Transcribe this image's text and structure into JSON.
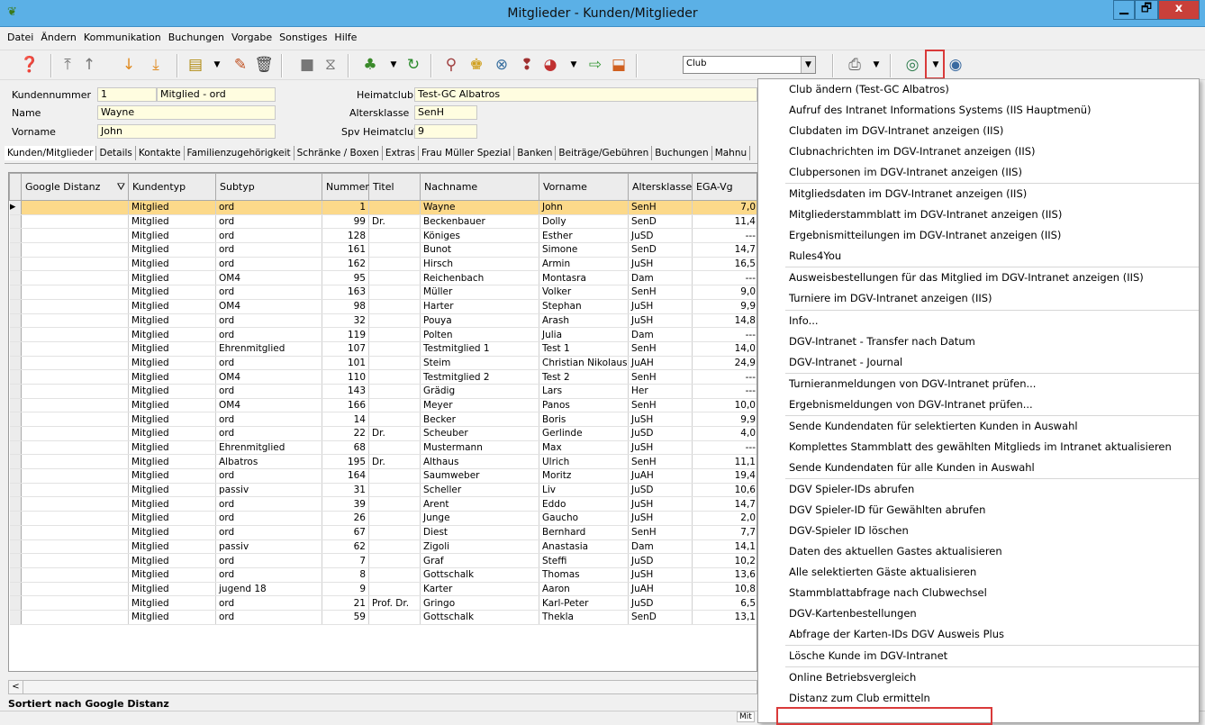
{
  "window": {
    "title": "Mitglieder - Kunden/Mitglieder",
    "min": "▁",
    "max": "🗗",
    "close": "x"
  },
  "menubar": [
    "Datei",
    "Ändern",
    "Kommunikation",
    "Buchungen",
    "Vorgabe",
    "Sonstiges",
    "Hilfe"
  ],
  "toolbar": {
    "combo_value": "Club",
    "icons": [
      "help-icon",
      "move-top-icon",
      "move-up-icon",
      "move-down-icon",
      "move-bottom-icon",
      "document-icon",
      "edit-pencil-icon",
      "delete-icon",
      "stop-icon",
      "filter-icon",
      "people-icon",
      "refresh-icon",
      "search-person-icon",
      "group-icon",
      "lifebuoy-icon",
      "question-icon",
      "pie-chart-icon",
      "export-icon",
      "import-icon",
      "print-icon",
      "intranet-icon",
      "intranet-globe-icon"
    ]
  },
  "form": {
    "kundennummer_label": "Kundennummer",
    "kundennummer": "1",
    "mitglied_typ": "Mitglied - ord",
    "name_label": "Name",
    "name": "Wayne",
    "vorname_label": "Vorname",
    "vorname": "John",
    "heimatclub_label": "Heimatclub",
    "heimatclub": "Test-GC Albatros",
    "altersklasse_label": "Altersklasse",
    "altersklasse": "SenH",
    "spv_label": "Spv Heimatclub",
    "spv": "9"
  },
  "tabs": [
    "Kunden/Mitglieder",
    "Details",
    "Kontakte",
    "Familienzugehörigkeit",
    "Schränke / Boxen",
    "Extras",
    "Frau Müller Spezial",
    "Banken",
    "Beiträge/Gebühren",
    "Buchungen",
    "Mahnu"
  ],
  "grid": {
    "columns": [
      "Google Distanz",
      "Kundentyp",
      "Subtyp",
      "Nummer",
      "Titel",
      "Nachname",
      "Vorname",
      "Altersklasse",
      "EGA-Vg"
    ],
    "rows": [
      [
        "",
        "Mitglied",
        "ord",
        "1",
        "",
        "Wayne",
        "John",
        "SenH",
        "7,0"
      ],
      [
        "",
        "Mitglied",
        "ord",
        "99",
        "Dr.",
        "Beckenbauer",
        "Dolly",
        "SenD",
        "11,4"
      ],
      [
        "",
        "Mitglied",
        "ord",
        "128",
        "",
        "Königes",
        "Esther",
        "JuSD",
        "---"
      ],
      [
        "",
        "Mitglied",
        "ord",
        "161",
        "",
        "Bunot",
        "Simone",
        "SenD",
        "14,7"
      ],
      [
        "",
        "Mitglied",
        "ord",
        "162",
        "",
        "Hirsch",
        "Armin",
        "JuSH",
        "16,5"
      ],
      [
        "",
        "Mitglied",
        "OM4",
        "95",
        "",
        "Reichenbach",
        "Montasra",
        "Dam",
        "---"
      ],
      [
        "",
        "Mitglied",
        "ord",
        "163",
        "",
        "Müller",
        "Volker",
        "SenH",
        "9,0"
      ],
      [
        "",
        "Mitglied",
        "OM4",
        "98",
        "",
        "Harter",
        "Stephan",
        "JuSH",
        "9,9"
      ],
      [
        "",
        "Mitglied",
        "ord",
        "32",
        "",
        "Pouya",
        "Arash",
        "JuSH",
        "14,8"
      ],
      [
        "",
        "Mitglied",
        "ord",
        "119",
        "",
        "Polten",
        "Julia",
        "Dam",
        "---"
      ],
      [
        "",
        "Mitglied",
        "Ehrenmitglied",
        "107",
        "",
        "Testmitglied 1",
        "Test 1",
        "SenH",
        "14,0"
      ],
      [
        "",
        "Mitglied",
        "ord",
        "101",
        "",
        "Steim",
        "Christian Nikolaus",
        "JuAH",
        "24,9"
      ],
      [
        "",
        "Mitglied",
        "OM4",
        "110",
        "",
        "Testmitglied 2",
        "Test 2",
        "SenH",
        "---"
      ],
      [
        "",
        "Mitglied",
        "ord",
        "143",
        "",
        "Grädig",
        "Lars",
        "Her",
        "---"
      ],
      [
        "",
        "Mitglied",
        "OM4",
        "166",
        "",
        "Meyer",
        "Panos",
        "SenH",
        "10,0"
      ],
      [
        "",
        "Mitglied",
        "ord",
        "14",
        "",
        "Becker",
        "Boris",
        "JuSH",
        "9,9"
      ],
      [
        "",
        "Mitglied",
        "ord",
        "22",
        "Dr.",
        "Scheuber",
        "Gerlinde",
        "JuSD",
        "4,0"
      ],
      [
        "",
        "Mitglied",
        "Ehrenmitglied",
        "68",
        "",
        "Mustermann",
        "Max",
        "JuSH",
        "---"
      ],
      [
        "",
        "Mitglied",
        "Albatros",
        "195",
        "Dr.",
        "Althaus",
        "Ulrich",
        "SenH",
        "11,1"
      ],
      [
        "",
        "Mitglied",
        "ord",
        "164",
        "",
        "Saumweber",
        "Moritz",
        "JuAH",
        "19,4"
      ],
      [
        "",
        "Mitglied",
        "passiv",
        "31",
        "",
        "Scheller",
        "Liv",
        "JuSD",
        "10,6"
      ],
      [
        "",
        "Mitglied",
        "ord",
        "39",
        "",
        "Arent",
        "Eddo",
        "JuSH",
        "14,7"
      ],
      [
        "",
        "Mitglied",
        "ord",
        "26",
        "",
        "Junge",
        "Gaucho",
        "JuSH",
        "2,0"
      ],
      [
        "",
        "Mitglied",
        "ord",
        "67",
        "",
        "Diest",
        "Bernhard",
        "SenH",
        "7,7"
      ],
      [
        "",
        "Mitglied",
        "passiv",
        "62",
        "",
        "Zigoli",
        "Anastasia",
        "Dam",
        "14,1"
      ],
      [
        "",
        "Mitglied",
        "ord",
        "7",
        "",
        "Graf",
        "Steffi",
        "JuSD",
        "10,2"
      ],
      [
        "",
        "Mitglied",
        "ord",
        "8",
        "",
        "Gottschalk",
        "Thomas",
        "JuSH",
        "13,6"
      ],
      [
        "",
        "Mitglied",
        "jugend 18",
        "9",
        "",
        "Karter",
        "Aaron",
        "JuAH",
        "10,8"
      ],
      [
        "",
        "Mitglied",
        "ord",
        "21",
        "Prof. Dr.",
        "Gringo",
        "Karl-Peter",
        "JuSD",
        "6,5"
      ],
      [
        "",
        "Mitglied",
        "ord",
        "59",
        "",
        "Gottschalk",
        "Thekla",
        "SenD",
        "13,1"
      ]
    ]
  },
  "status": "Sortiert nach Google Distanz",
  "bottom_fragment": "Mit",
  "context_menu": [
    {
      "label": "Club ändern (Test-GC Albatros)",
      "sep": false
    },
    {
      "label": "Aufruf des Intranet Informations Systems (IIS Hauptmenü)",
      "sep": false
    },
    {
      "label": "Clubdaten im DGV-Intranet anzeigen (IIS)",
      "sep": false
    },
    {
      "label": "Clubnachrichten im DGV-Intranet anzeigen (IIS)",
      "sep": false
    },
    {
      "label": "Clubpersonen im DGV-Intranet anzeigen (IIS)",
      "sep": true
    },
    {
      "label": "Mitgliedsdaten im DGV-Intranet anzeigen (IIS)",
      "sep": false
    },
    {
      "label": "Mitgliederstammblatt im DGV-Intranet anzeigen (IIS)",
      "sep": false
    },
    {
      "label": "Ergebnismitteilungen im DGV-Intranet anzeigen (IIS)",
      "sep": false
    },
    {
      "label": "Rules4You",
      "sep": true
    },
    {
      "label": "Ausweisbestellungen für das Mitglied im DGV-Intranet anzeigen (IIS)",
      "sep": false
    },
    {
      "label": "Turniere im DGV-Intranet anzeigen (IIS)",
      "sep": true
    },
    {
      "label": "Info...",
      "sep": false
    },
    {
      "label": "DGV-Intranet - Transfer nach Datum",
      "sep": false
    },
    {
      "label": "DGV-Intranet - Journal",
      "sep": true
    },
    {
      "label": "Turnieranmeldungen von DGV-Intranet prüfen...",
      "sep": false
    },
    {
      "label": "Ergebnismeldungen von DGV-Intranet prüfen...",
      "sep": true
    },
    {
      "label": "Sende Kundendaten für selektierten Kunden in Auswahl",
      "sep": false
    },
    {
      "label": "Komplettes Stammblatt des gewählten Mitglieds im Intranet aktualisieren",
      "sep": false
    },
    {
      "label": "Sende Kundendaten für alle Kunden in Auswahl",
      "sep": true
    },
    {
      "label": "DGV Spieler-IDs abrufen",
      "sep": false
    },
    {
      "label": "DGV Spieler-ID für Gewählten abrufen",
      "sep": false
    },
    {
      "label": "DGV-Spieler ID löschen",
      "sep": false
    },
    {
      "label": "Daten des aktuellen Gastes aktualisieren",
      "sep": false
    },
    {
      "label": "Alle selektierten Gäste aktualisieren",
      "sep": false
    },
    {
      "label": "Stammblattabfrage nach Clubwechsel",
      "sep": false
    },
    {
      "label": "DGV-Kartenbestellungen",
      "sep": false
    },
    {
      "label": "Abfrage der Karten-IDs DGV Ausweis Plus",
      "sep": true
    },
    {
      "label": "Lösche Kunde im DGV-Intranet",
      "sep": true
    },
    {
      "label": "Online Betriebsvergleich",
      "sep": false
    },
    {
      "label": "Distanz zum Club ermitteln",
      "sep": false
    }
  ]
}
